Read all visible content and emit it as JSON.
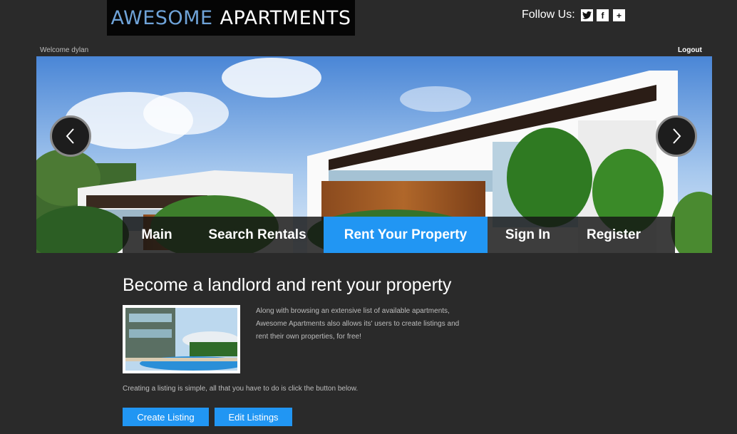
{
  "header": {
    "logo_word1": "AWESOME",
    "logo_word2": "APARTMENTS",
    "follow_label": "Follow Us:",
    "social_icons": [
      "twitter-icon",
      "facebook-icon",
      "plus-icon"
    ]
  },
  "user": {
    "welcome": "Welcome dylan",
    "logout": "Logout"
  },
  "nav": {
    "items": [
      {
        "label": "Main"
      },
      {
        "label": "Search Rentals"
      },
      {
        "label": "Rent Your Property"
      },
      {
        "label": "Sign In"
      },
      {
        "label": "Register"
      }
    ],
    "active_label": "Rent Your Property"
  },
  "content": {
    "heading": "Become a landlord and rent your property",
    "description": "Along with browsing an extensive list of available apartments, Awesome Apartments also allows its' users to create listings and rent their own properties, for free!",
    "instruction": "Creating a listing is simple, all that you have to do is click the button below.",
    "create_button": "Create Listing",
    "edit_button": "Edit Listings"
  },
  "colors": {
    "accent": "#2196f3",
    "background": "#2a2a2a"
  }
}
